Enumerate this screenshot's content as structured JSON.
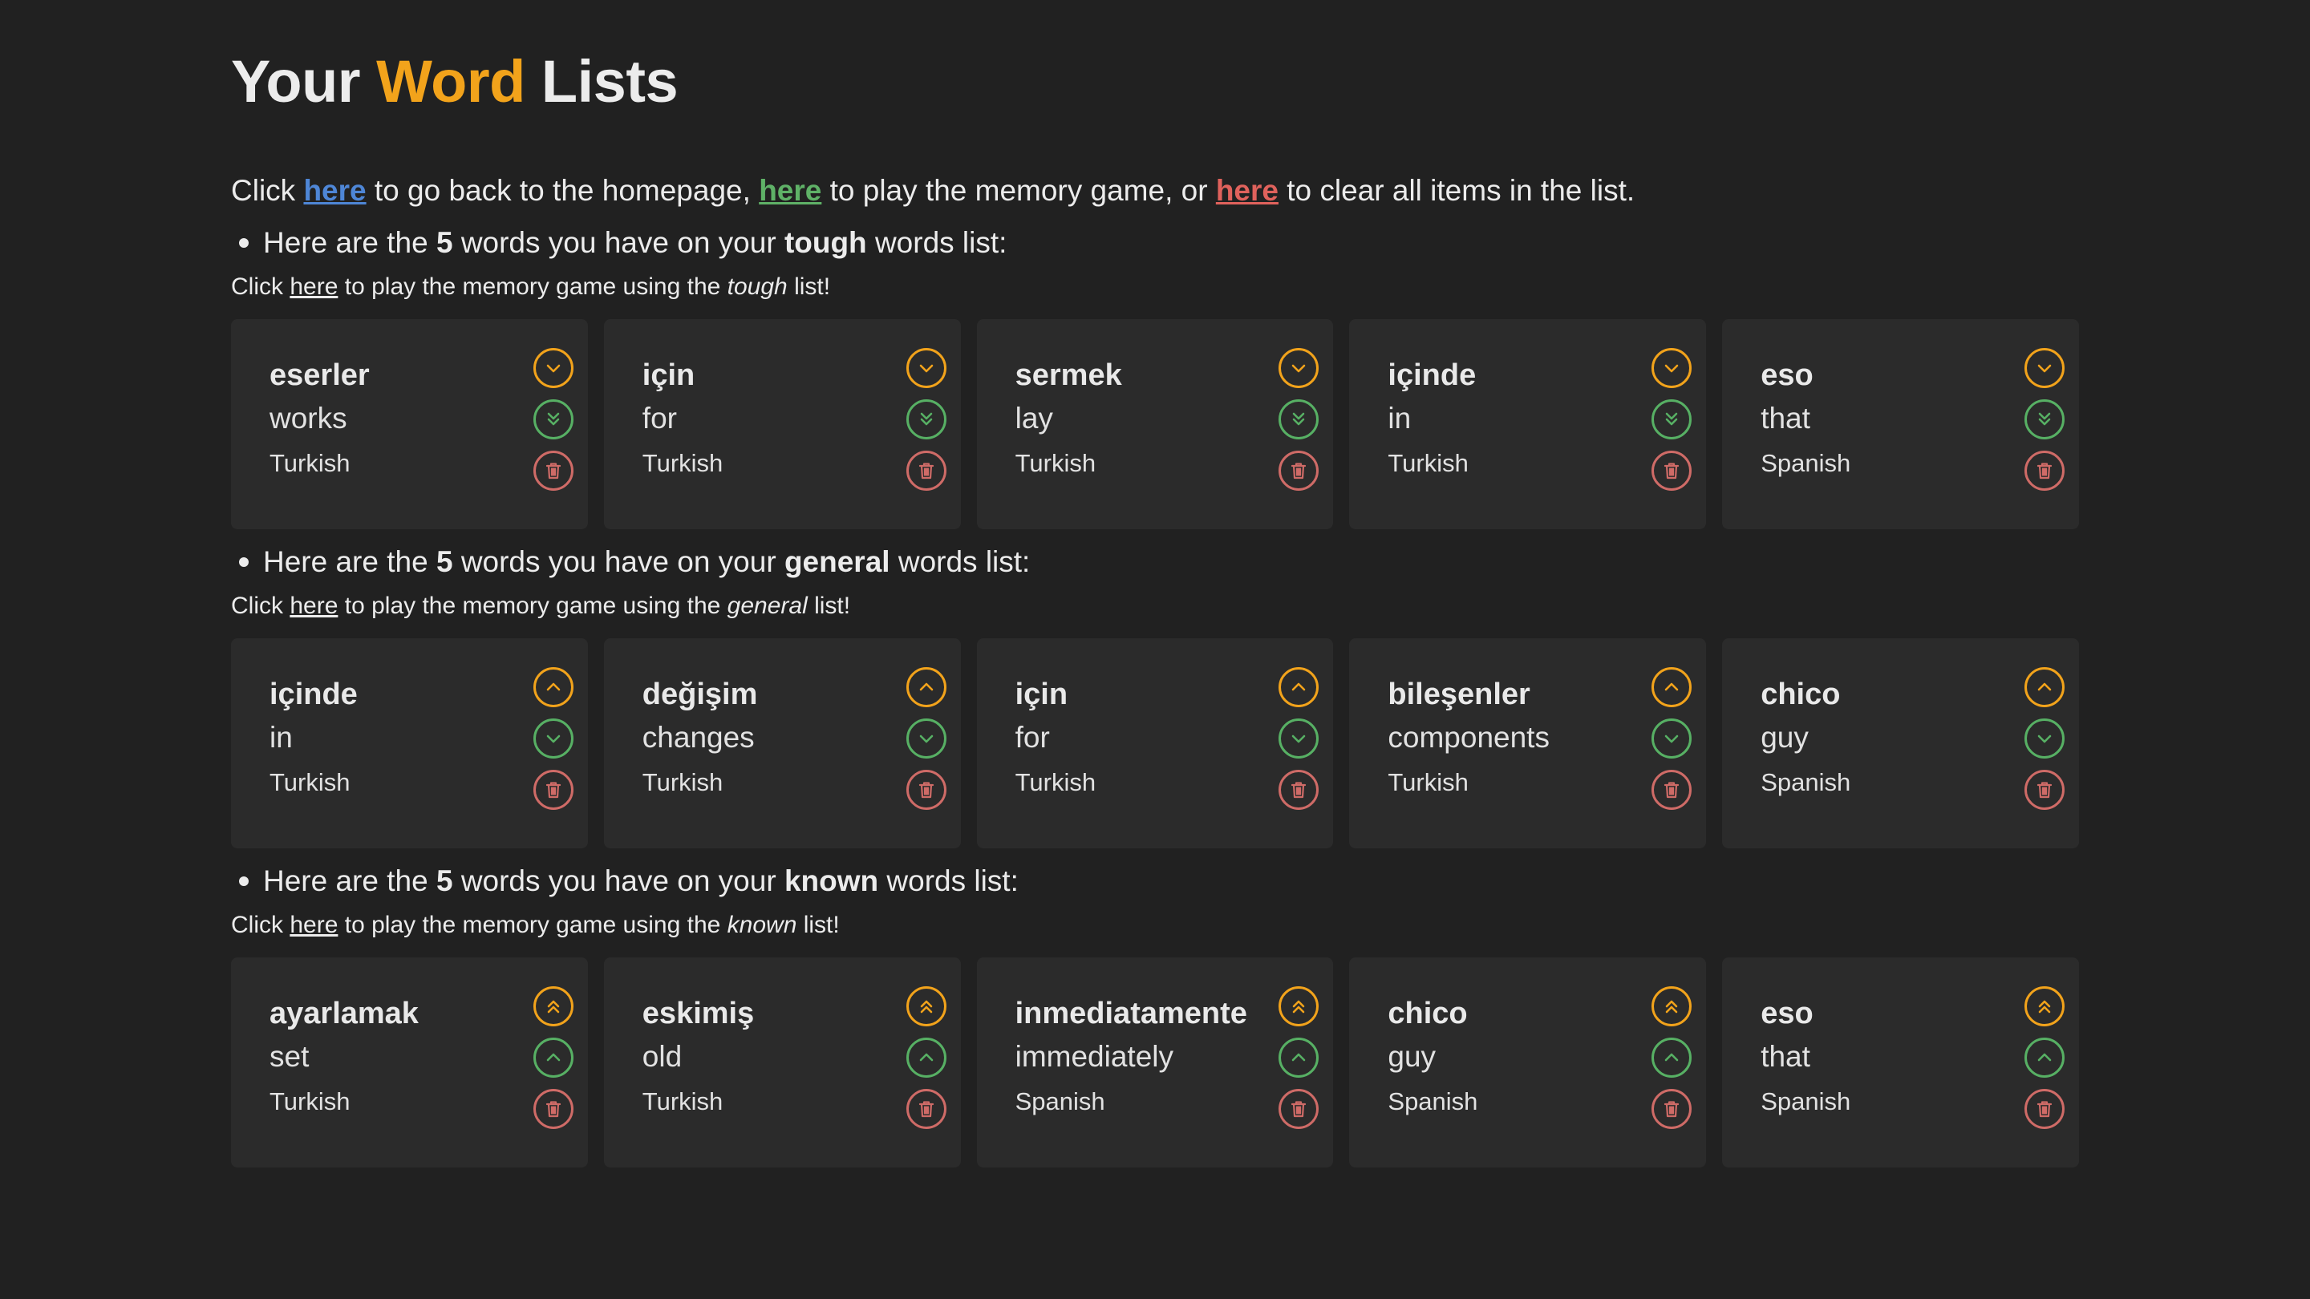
{
  "title": {
    "part1": "Your",
    "accent": "Word",
    "part2": "Lists"
  },
  "intro": {
    "t1": "Click",
    "home_link": "here",
    "t2": "to go back to the homepage,",
    "game_link": "here",
    "t3": "to play the memory game, or",
    "clear_link": "here",
    "t4": "to clear all items in the list."
  },
  "colors": {
    "accent": "#f2a31b",
    "home": "#4e86d6",
    "game": "#5fb167",
    "clear": "#e0625c",
    "background": "#212121",
    "card": "#2b2b2b"
  },
  "sections": [
    {
      "head_pre": "Here are the",
      "count": "5",
      "head_mid": "words you have on your",
      "list_name": "tough",
      "head_post": "words list:",
      "sub_pre": "Click",
      "sub_link": "here",
      "sub_mid": "to play the memory game using the",
      "sub_list": "tough",
      "sub_post": "list!",
      "buttons": [
        "chevron-down-icon",
        "double-chevron-down-icon",
        "trash-icon"
      ],
      "cards": [
        {
          "word": "eserler",
          "translation": "works",
          "language": "Turkish"
        },
        {
          "word": "için",
          "translation": "for",
          "language": "Turkish"
        },
        {
          "word": "sermek",
          "translation": "lay",
          "language": "Turkish"
        },
        {
          "word": "içinde",
          "translation": "in",
          "language": "Turkish"
        },
        {
          "word": "eso",
          "translation": "that",
          "language": "Spanish"
        }
      ]
    },
    {
      "head_pre": "Here are the",
      "count": "5",
      "head_mid": "words you have on your",
      "list_name": "general",
      "head_post": "words list:",
      "sub_pre": "Click",
      "sub_link": "here",
      "sub_mid": "to play the memory game using the",
      "sub_list": "general",
      "sub_post": "list!",
      "buttons": [
        "chevron-up-icon",
        "chevron-down-icon",
        "trash-icon"
      ],
      "cards": [
        {
          "word": "içinde",
          "translation": "in",
          "language": "Turkish"
        },
        {
          "word": "değişim",
          "translation": "changes",
          "language": "Turkish"
        },
        {
          "word": "için",
          "translation": "for",
          "language": "Turkish"
        },
        {
          "word": "bileşenler",
          "translation": "components",
          "language": "Turkish"
        },
        {
          "word": "chico",
          "translation": "guy",
          "language": "Spanish"
        }
      ]
    },
    {
      "head_pre": "Here are the",
      "count": "5",
      "head_mid": "words you have on your",
      "list_name": "known",
      "head_post": "words list:",
      "sub_pre": "Click",
      "sub_link": "here",
      "sub_mid": "to play the memory game using the",
      "sub_list": "known",
      "sub_post": "list!",
      "buttons": [
        "double-chevron-up-icon",
        "chevron-up-icon",
        "trash-icon"
      ],
      "cards": [
        {
          "word": "ayarlamak",
          "translation": "set",
          "language": "Turkish"
        },
        {
          "word": "eskimiş",
          "translation": "old",
          "language": "Turkish"
        },
        {
          "word": "inmediatamente",
          "translation": "immediately",
          "language": "Spanish"
        },
        {
          "word": "chico",
          "translation": "guy",
          "language": "Spanish"
        },
        {
          "word": "eso",
          "translation": "that",
          "language": "Spanish"
        }
      ]
    }
  ]
}
